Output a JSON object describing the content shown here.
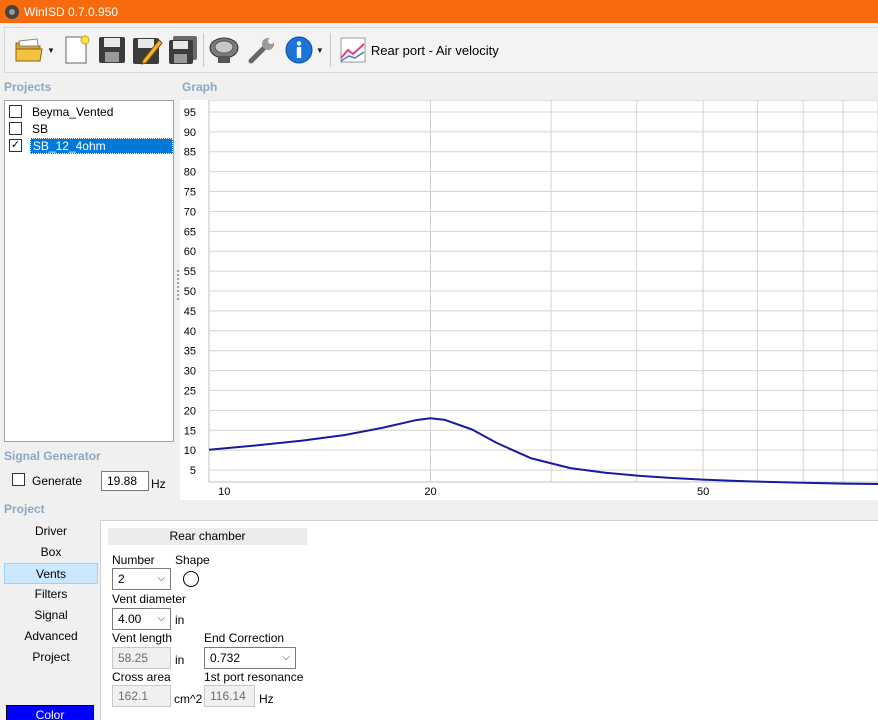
{
  "window": {
    "title": "WinISD 0.7.0.950"
  },
  "toolbar": {
    "graph_label": "Rear port - Air velocity",
    "icons": [
      "open-folder-icon",
      "new-document-icon",
      "save-icon",
      "save-as-icon",
      "save-all-icon",
      "speaker-icon",
      "wrench-icon",
      "info-icon",
      "graph-icon"
    ]
  },
  "projects": {
    "header": "Projects",
    "items": [
      {
        "name": "Beyma_Vented",
        "checked": false
      },
      {
        "name": "SB",
        "checked": false
      },
      {
        "name": "SB_12_4ohm",
        "checked": true
      }
    ]
  },
  "graph": {
    "header": "Graph",
    "chart_data": {
      "type": "line",
      "x_scale": "log",
      "xlim": [
        9.5,
        90
      ],
      "ylim": [
        2,
        98
      ],
      "y_ticks": [
        5,
        10,
        15,
        20,
        25,
        30,
        35,
        40,
        45,
        50,
        55,
        60,
        65,
        70,
        75,
        80,
        85,
        90,
        95
      ],
      "x_tick_labels": [
        10,
        20,
        50
      ],
      "x_gridlines": [
        20,
        30,
        40,
        50,
        60,
        70,
        80,
        90
      ],
      "grid": true,
      "color": "#1a1aa0",
      "series": [
        {
          "x": [
            9.5,
            11,
            13,
            15,
            17,
            19,
            20,
            21,
            23,
            25,
            28,
            32,
            36,
            40,
            45,
            50,
            55,
            60,
            70,
            80,
            90
          ],
          "y": [
            10.1,
            11.1,
            12.4,
            13.8,
            15.6,
            17.5,
            18.0,
            17.6,
            15.2,
            11.8,
            8.0,
            5.5,
            4.3,
            3.6,
            3.0,
            2.6,
            2.3,
            2.1,
            1.8,
            1.6,
            1.5
          ]
        }
      ]
    }
  },
  "signal_generator": {
    "header": "Signal Generator",
    "generate_label": "Generate",
    "generate_checked": false,
    "frequency": "19.88",
    "unit": "Hz"
  },
  "project": {
    "header": "Project",
    "nav": [
      "Driver",
      "Box",
      "Vents",
      "Filters",
      "Signal",
      "Advanced",
      "Project"
    ],
    "active_nav": "Vents",
    "color_button": "Color",
    "color_value": "#0000ff"
  },
  "vents": {
    "tab": "Rear chamber",
    "number_label": "Number",
    "number_value": "2",
    "shape_label": "Shape",
    "vent_diameter_label": "Vent diameter",
    "vent_diameter_value": "4.00",
    "vent_diameter_unit": "in",
    "vent_length_label": "Vent length",
    "vent_length_value": "58.25",
    "vent_length_unit": "in",
    "end_correction_label": "End Correction",
    "end_correction_value": "0.732",
    "cross_area_label": "Cross area",
    "cross_area_value": "162.1",
    "cross_area_unit": "cm^2",
    "port_resonance_label": "1st port resonance",
    "port_resonance_value": "116.14",
    "port_resonance_unit": "Hz"
  }
}
